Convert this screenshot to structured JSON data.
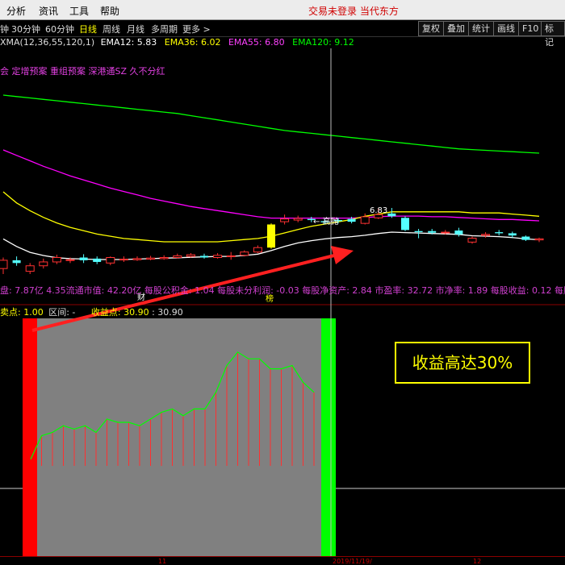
{
  "menu": {
    "items": [
      "分析",
      "资讯",
      "工具",
      "帮助"
    ],
    "broker_text": "交易未登录  当代东方"
  },
  "periods": {
    "items": [
      "钟",
      "30分钟",
      "60分钟",
      "日线",
      "周线",
      "月线",
      "多周期",
      "更多 >"
    ],
    "active": "日线"
  },
  "toolbar": {
    "buttons": [
      "复权",
      "叠加",
      "统计",
      "画线",
      "F10",
      "标记"
    ]
  },
  "indicators": {
    "title": "XMA(12,36,55,120,1)",
    "ema12": "EMA12: 5.83",
    "ema36": "EMA36: 6.02",
    "ema55": "EMA55: 6.80",
    "ema120": "EMA120: 9.12"
  },
  "tags": "会 定增预案 重组预案 深港通SZ 久不分红",
  "price_labels": {
    "high_label": "6.83",
    "high_tag": "← 高抛",
    "bang_label": "榜",
    "cai_label": "财"
  },
  "stats": "盘: 7.87亿  4.35流通市值: 42.20亿   每股公积金: 1.04   每股未分利润: -0.03   每股净资产: 2.84   市盈率: 32.72   市净率: 1.89   每股收益: 0.12   每股现",
  "pane2": {
    "sell_label": "卖点: 1.00",
    "range_label": "区间: -",
    "profit_label": "收益点: 30.90",
    "profit_value": ": 30.90"
  },
  "profit_box": "收益高达30%",
  "dates": [
    "11",
    "2019/11/19/",
    "12"
  ],
  "chart_data": {
    "type": "line",
    "candles": [
      {
        "o": 5.3,
        "c": 5.45,
        "h": 5.5,
        "l": 5.2
      },
      {
        "o": 5.45,
        "c": 5.4,
        "h": 5.52,
        "l": 5.35
      },
      {
        "o": 5.25,
        "c": 5.35,
        "h": 5.4,
        "l": 5.2
      },
      {
        "o": 5.35,
        "c": 5.42,
        "h": 5.48,
        "l": 5.3
      },
      {
        "o": 5.42,
        "c": 5.5,
        "h": 5.55,
        "l": 5.38
      },
      {
        "o": 5.46,
        "c": 5.46,
        "h": 5.5,
        "l": 5.4
      },
      {
        "o": 5.5,
        "c": 5.45,
        "h": 5.56,
        "l": 5.4
      },
      {
        "o": 5.48,
        "c": 5.42,
        "h": 5.52,
        "l": 5.38
      },
      {
        "o": 5.4,
        "c": 5.5,
        "h": 5.52,
        "l": 5.36
      },
      {
        "o": 5.47,
        "c": 5.47,
        "h": 5.52,
        "l": 5.42
      },
      {
        "o": 5.46,
        "c": 5.48,
        "h": 5.52,
        "l": 5.44
      },
      {
        "o": 5.47,
        "c": 5.49,
        "h": 5.53,
        "l": 5.45
      },
      {
        "o": 5.48,
        "c": 5.5,
        "h": 5.54,
        "l": 5.46
      },
      {
        "o": 5.5,
        "c": 5.53,
        "h": 5.57,
        "l": 5.48
      },
      {
        "o": 5.52,
        "c": 5.55,
        "h": 5.58,
        "l": 5.5
      },
      {
        "o": 5.53,
        "c": 5.5,
        "h": 5.57,
        "l": 5.48
      },
      {
        "o": 5.5,
        "c": 5.54,
        "h": 5.58,
        "l": 5.48
      },
      {
        "o": 5.53,
        "c": 5.53,
        "h": 5.6,
        "l": 5.46
      },
      {
        "o": 5.54,
        "c": 5.6,
        "h": 5.63,
        "l": 5.52
      },
      {
        "o": 5.6,
        "c": 5.68,
        "h": 5.72,
        "l": 5.58
      },
      {
        "o": 5.68,
        "c": 6.1,
        "h": 6.12,
        "l": 5.66
      },
      {
        "o": 6.15,
        "c": 6.2,
        "h": 6.28,
        "l": 6.1
      },
      {
        "o": 6.18,
        "c": 6.21,
        "h": 6.26,
        "l": 6.14
      },
      {
        "o": 6.2,
        "c": 6.18,
        "h": 6.24,
        "l": 6.14
      },
      {
        "o": 6.16,
        "c": 6.14,
        "h": 6.2,
        "l": 6.1
      },
      {
        "o": 6.18,
        "c": 6.16,
        "h": 6.22,
        "l": 6.12
      },
      {
        "o": 6.2,
        "c": 6.15,
        "h": 6.24,
        "l": 6.12
      },
      {
        "o": 6.12,
        "c": 6.24,
        "h": 6.3,
        "l": 6.1
      },
      {
        "o": 6.22,
        "c": 6.28,
        "h": 6.4,
        "l": 6.2
      },
      {
        "o": 6.3,
        "c": 6.25,
        "h": 6.4,
        "l": 6.22
      },
      {
        "o": 6.22,
        "c": 6.0,
        "h": 6.25,
        "l": 5.98
      },
      {
        "o": 5.98,
        "c": 5.96,
        "h": 6.02,
        "l": 5.85
      },
      {
        "o": 5.98,
        "c": 5.95,
        "h": 6.02,
        "l": 5.92
      },
      {
        "o": 5.96,
        "c": 5.96,
        "h": 6.0,
        "l": 5.92
      },
      {
        "o": 5.99,
        "c": 5.92,
        "h": 6.04,
        "l": 5.88
      },
      {
        "o": 5.78,
        "c": 5.85,
        "h": 5.88,
        "l": 5.75
      },
      {
        "o": 5.9,
        "c": 5.92,
        "h": 5.96,
        "l": 5.86
      },
      {
        "o": 5.96,
        "c": 5.94,
        "h": 6.0,
        "l": 5.9
      },
      {
        "o": 5.94,
        "c": 5.9,
        "h": 5.97,
        "l": 5.86
      },
      {
        "o": 5.88,
        "c": 5.82,
        "h": 5.9,
        "l": 5.8
      },
      {
        "o": 5.82,
        "c": 5.84,
        "h": 5.86,
        "l": 5.78
      }
    ],
    "ema12": [
      5.92,
      5.75,
      5.62,
      5.55,
      5.5,
      5.48,
      5.47,
      5.46,
      5.46,
      5.46,
      5.47,
      5.48,
      5.49,
      5.5,
      5.51,
      5.52,
      5.53,
      5.53,
      5.55,
      5.58,
      5.66,
      5.75,
      5.83,
      5.88,
      5.92,
      5.95,
      5.97,
      6.0,
      6.04,
      6.07,
      6.06,
      6.05,
      6.04,
      6.03,
      6.02,
      5.99,
      5.98,
      5.97,
      5.95,
      5.92,
      5.9
    ],
    "ema36": [
      6.2,
      6.1,
      6.03,
      5.97,
      5.92,
      5.88,
      5.85,
      5.82,
      5.8,
      5.78,
      5.77,
      5.76,
      5.75,
      5.75,
      5.75,
      5.75,
      5.75,
      5.76,
      5.77,
      5.78,
      5.8,
      5.83,
      5.86,
      5.89,
      5.91,
      5.93,
      5.95,
      5.98,
      6.0,
      6.02,
      6.02,
      6.02,
      6.02,
      6.02,
      6.02,
      6.01,
      6.01,
      6.01,
      6.0,
      5.99,
      5.98
    ],
    "ema55": [
      7.7,
      7.62,
      7.54,
      7.46,
      7.39,
      7.32,
      7.26,
      7.2,
      7.14,
      7.09,
      7.04,
      6.99,
      6.95,
      6.91,
      6.87,
      6.84,
      6.81,
      6.78,
      6.75,
      6.72,
      6.7,
      6.7,
      6.7,
      6.7,
      6.7,
      6.7,
      6.7,
      6.71,
      6.72,
      6.73,
      6.73,
      6.73,
      6.72,
      6.72,
      6.71,
      6.7,
      6.69,
      6.68,
      6.68,
      6.67,
      6.66
    ],
    "ema120": [
      9.9,
      9.88,
      9.86,
      9.84,
      9.82,
      9.8,
      9.78,
      9.76,
      9.74,
      9.72,
      9.7,
      9.68,
      9.66,
      9.64,
      9.61,
      9.58,
      9.55,
      9.52,
      9.49,
      9.46,
      9.43,
      9.4,
      9.38,
      9.36,
      9.34,
      9.32,
      9.3,
      9.28,
      9.26,
      9.24,
      9.22,
      9.2,
      9.18,
      9.16,
      9.14,
      9.13,
      9.12,
      9.11,
      9.1,
      9.09,
      9.08
    ],
    "profit_curve": [
      2,
      9,
      10,
      12,
      11,
      12,
      10,
      14,
      13,
      13,
      12,
      14,
      16,
      17,
      15,
      17,
      17,
      22,
      30,
      34,
      32,
      32,
      29,
      29,
      30,
      25,
      22
    ]
  },
  "colors": {
    "candle_up": "#ff3232",
    "candle_down": "#54ffff",
    "ema12": "#ffffff",
    "ema36": "#ffff00",
    "ema55": "#ff00ff",
    "ema120": "#00ff00",
    "sell_zone": "#ff0000",
    "buy_zone": "#00ff00",
    "hold_zone": "#808080"
  }
}
